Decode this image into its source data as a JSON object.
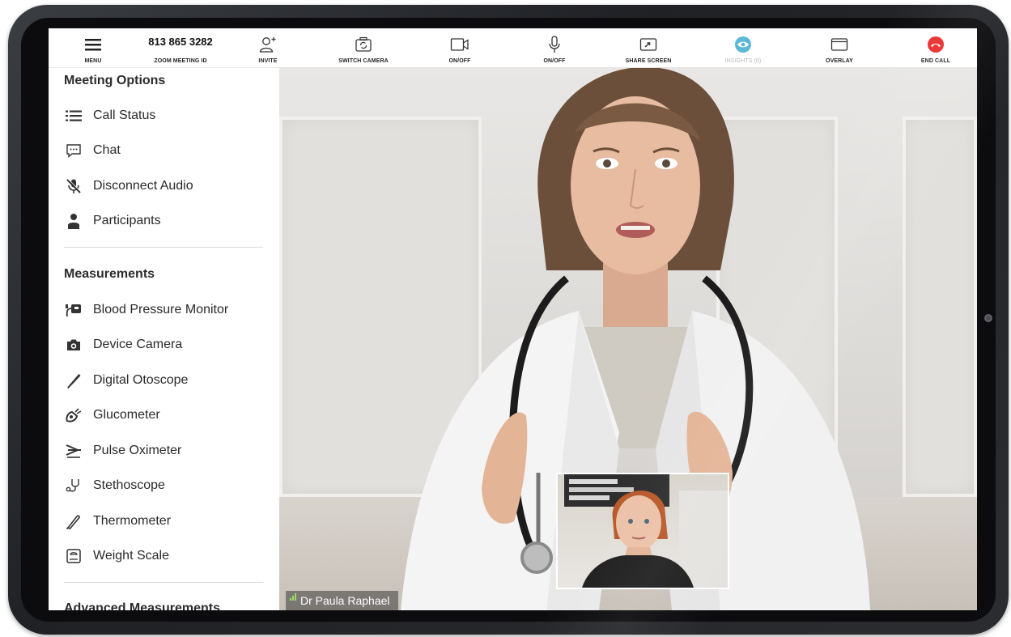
{
  "toolbar": {
    "menu_label": "MENU",
    "meeting_id": "813 865 3282",
    "meeting_id_label": "ZOOM MEETING ID",
    "invite_label": "INVITE",
    "switch_camera_label": "SWITCH CAMERA",
    "camera_toggle_label": "ON/OFF",
    "mic_toggle_label": "ON/OFF",
    "share_screen_label": "SHARE SCREEN",
    "insights_label": "INSIGHTS (0)",
    "overlay_label": "OVERLAY",
    "end_call_label": "END CALL"
  },
  "sidebar": {
    "meeting_options_title": "Meeting Options",
    "meeting_options": [
      {
        "label": "Call Status",
        "icon": "list-icon"
      },
      {
        "label": "Chat",
        "icon": "chat-icon"
      },
      {
        "label": "Disconnect Audio",
        "icon": "mic-off-icon"
      },
      {
        "label": "Participants",
        "icon": "person-icon"
      }
    ],
    "measurements_title": "Measurements",
    "measurements": [
      {
        "label": "Blood Pressure Monitor",
        "icon": "blood-pressure-icon"
      },
      {
        "label": "Device Camera",
        "icon": "camera-icon"
      },
      {
        "label": "Digital Otoscope",
        "icon": "otoscope-icon"
      },
      {
        "label": "Glucometer",
        "icon": "glucometer-icon"
      },
      {
        "label": "Pulse Oximeter",
        "icon": "pulse-oximeter-icon"
      },
      {
        "label": "Stethoscope",
        "icon": "stethoscope-icon"
      },
      {
        "label": "Thermometer",
        "icon": "thermometer-icon"
      },
      {
        "label": "Weight Scale",
        "icon": "weight-scale-icon"
      }
    ],
    "advanced_title": "Advanced Measurements"
  },
  "video": {
    "participant_name": "Dr Paula Raphael"
  },
  "colors": {
    "end_call": "#e8312f",
    "insights": "#5bb8d6"
  }
}
